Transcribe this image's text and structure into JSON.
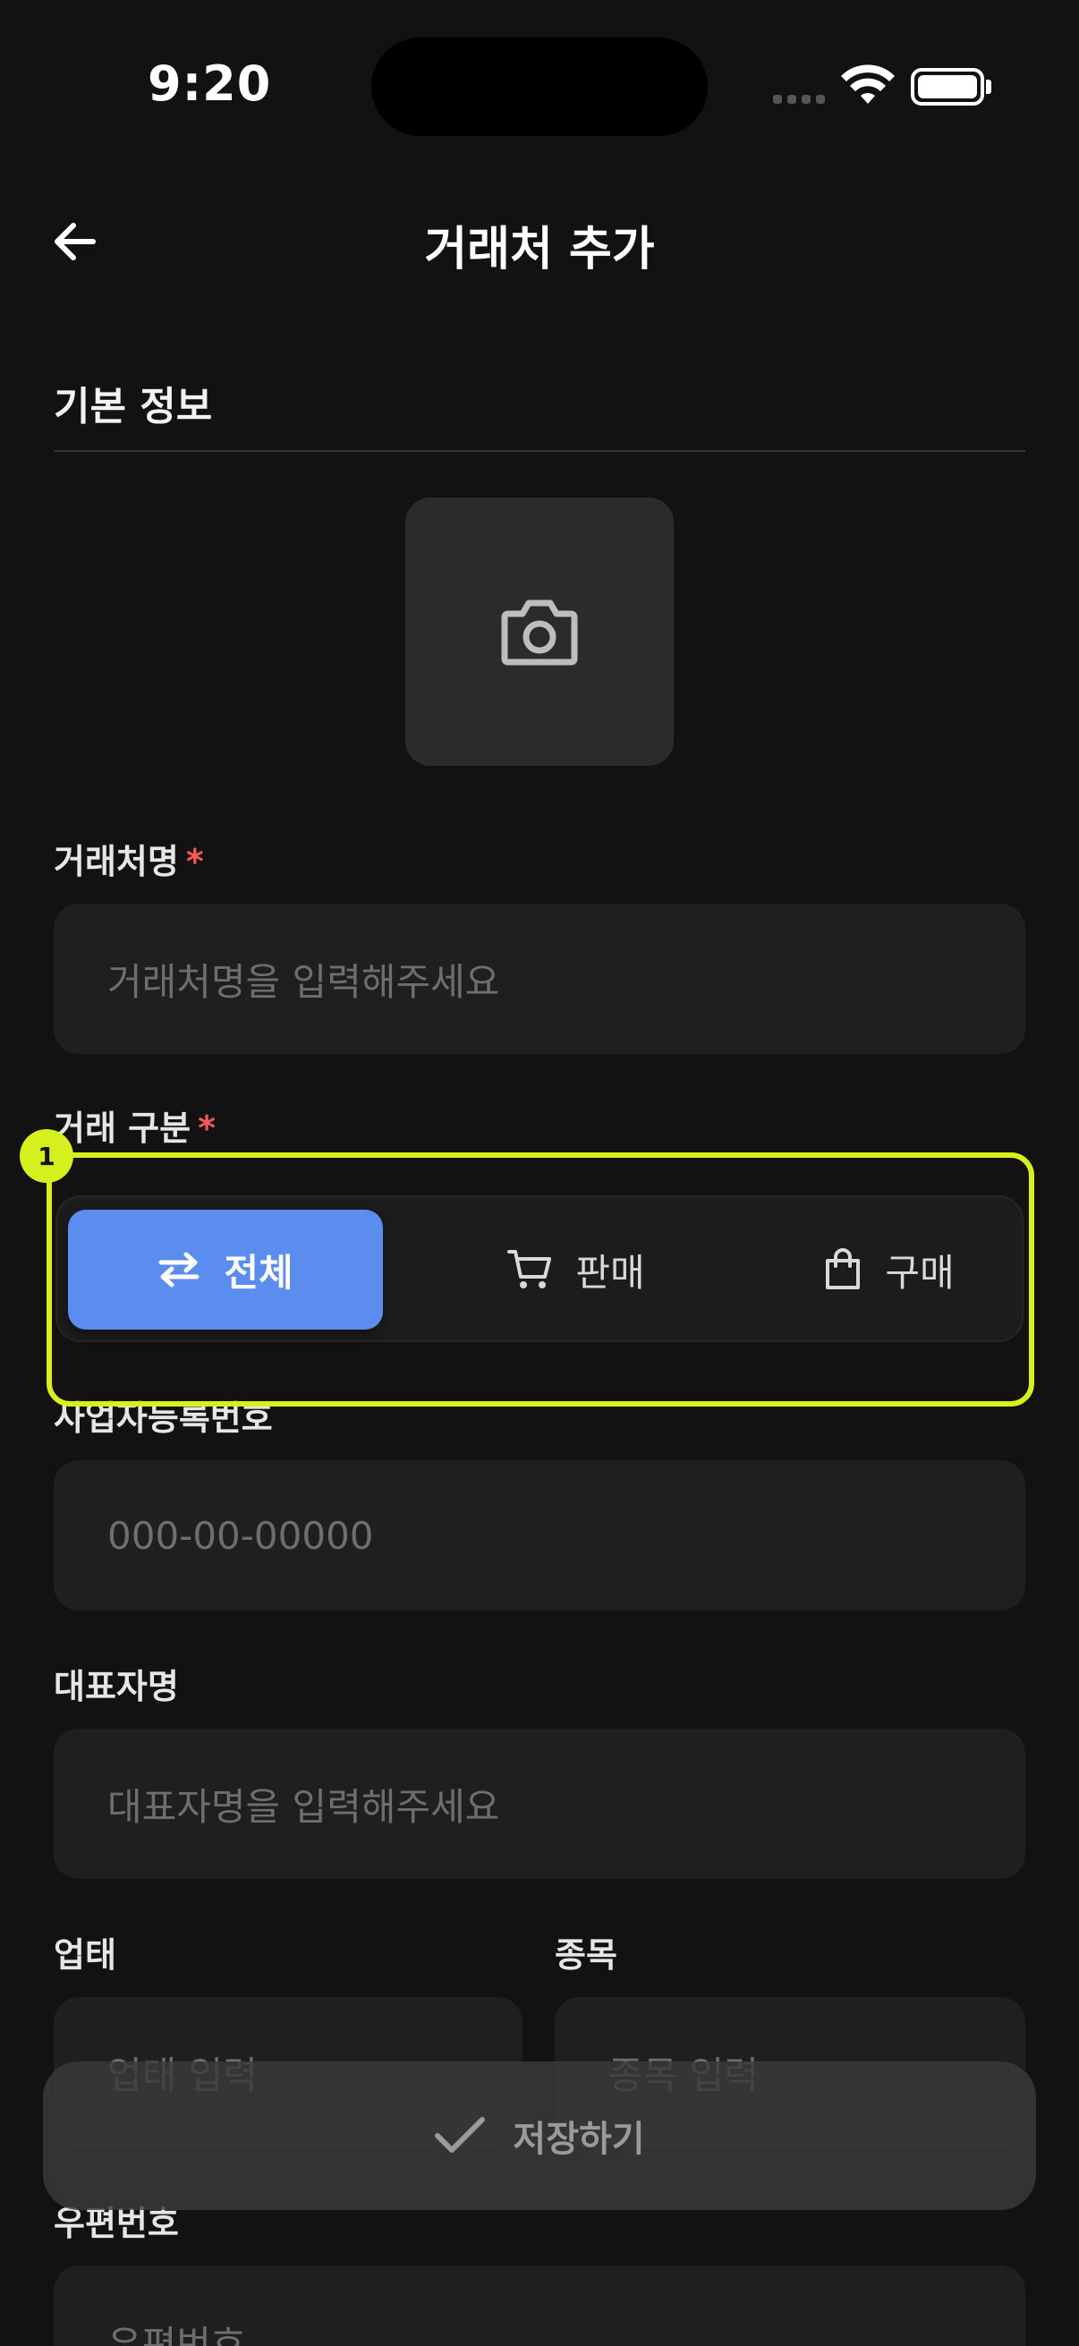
{
  "status": {
    "time": "9:20"
  },
  "header": {
    "title": "거래처 추가"
  },
  "section": {
    "title": "기본 정보"
  },
  "fields": {
    "name_label": "거래처명",
    "name_placeholder": "거래처명을 입력해주세요",
    "type_label": "거래 구분",
    "required_mark": "*",
    "biz_label": "사업자등록번호",
    "biz_placeholder": "000-00-00000",
    "ceo_label": "대표자명",
    "ceo_placeholder": "대표자명을 입력해주세요",
    "category_label": "업태",
    "category_placeholder": "업태 입력",
    "item_label": "종목",
    "item_placeholder": "종목 입력",
    "zip_label": "우편번호",
    "zip_placeholder": "우편번호"
  },
  "segment": {
    "all": "전체",
    "sale": "판매",
    "buy": "구매",
    "selected": "전체"
  },
  "annotation": {
    "badge": "1",
    "color": "#d6f01e"
  },
  "footer": {
    "save": "저장하기"
  },
  "colors": {
    "accent": "#5b8def",
    "required": "#ff5a5a",
    "background": "#121212"
  }
}
